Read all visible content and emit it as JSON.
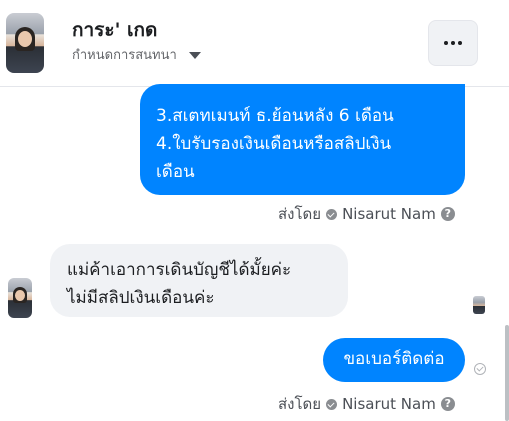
{
  "header": {
    "title": "การะ' เกด",
    "subtitle": "กำหนดการสนทนา",
    "more_icon": "more-horizontal-icon"
  },
  "messages": [
    {
      "direction": "outgoing",
      "lines": [
        "3.สเตทเมนท์ ธ.ย้อนหลัง 6 เดือน",
        "4.ใบรับรองเงินเดือนหรือสลิปเงิน",
        "เดือน"
      ],
      "sent_by_label": "ส่งโดย",
      "sender": "Nisarut Nam"
    },
    {
      "direction": "incoming",
      "lines": [
        "แม่ค้าเอาการเดินบัญชีได้มั้ยค่ะ",
        "ไม่มีสลิปเงินเดือนค่ะ"
      ]
    },
    {
      "direction": "outgoing",
      "lines": [
        "ขอเบอร์ติดต่อ"
      ],
      "sent_by_label": "ส่งโดย",
      "sender": "Nisarut Nam"
    }
  ],
  "help_glyph": "?",
  "colors": {
    "outgoing_bubble": "#0084ff",
    "incoming_bubble": "#f0f2f5",
    "secondary_text": "#65676b"
  }
}
